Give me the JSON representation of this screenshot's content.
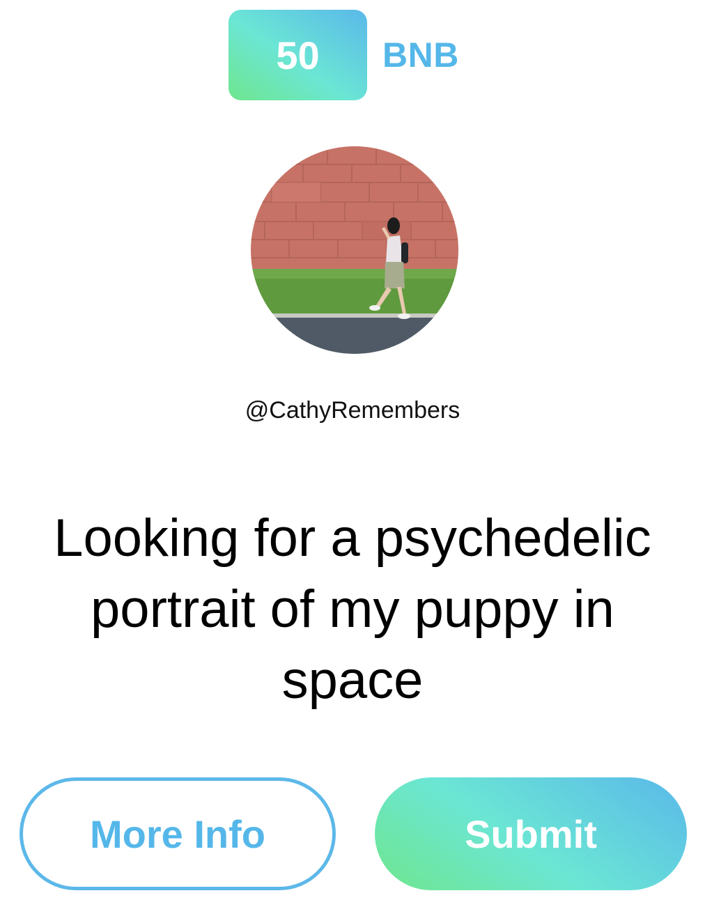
{
  "bounty": {
    "amount": "50",
    "currency": "BNB"
  },
  "profile": {
    "username": "@CathyRemembers"
  },
  "request": {
    "title": "Looking for a psychedelic portrait of my puppy in space"
  },
  "actions": {
    "more_info_label": "More Info",
    "submit_label": "Submit"
  },
  "colors": {
    "accent_blue": "#55b7e9",
    "gradient_green": "#6fe68e",
    "gradient_cyan": "#6be6d4",
    "gradient_blue": "#5ab8ea"
  }
}
